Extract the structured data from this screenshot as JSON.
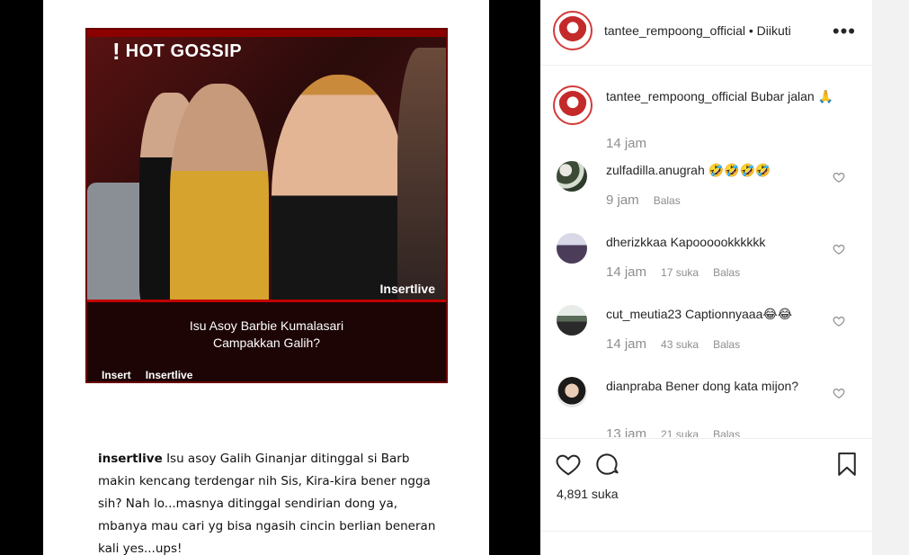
{
  "post": {
    "account": "tantee_rempoong_official",
    "separator": "•",
    "follow_status": "Diikuti",
    "caption": "Bubar jalan 🙏",
    "caption_time": "14 jam",
    "likes": "4,891 suka"
  },
  "media": {
    "badge": "HOT GOSSIP",
    "badge_icon": "!",
    "watermark": "Insertlive",
    "caption_line1": "Isu Asoy Barbie Kumalasari",
    "caption_line2": "Campakkan Galih?",
    "footer_logo1": "Insert",
    "footer_logo2": "Insertlive",
    "text_user": "insertlive",
    "text_body": "Isu asoy Galih Ginanjar ditinggal si Barb makin kencang terdengar nih Sis, Kira-kira bener ngga sih? Nah lo...masnya ditinggal sendirian dong ya, mbanya mau cari yg bisa ngasih cincin berlian beneran kali yes...ups!"
  },
  "comments": [
    {
      "user": "zulfadilla.anugrah",
      "text": "🤣🤣🤣🤣",
      "time": "9 jam",
      "likes": "",
      "reply": "Balas"
    },
    {
      "user": "dherizkkaa",
      "text": "Kapoooookkkkkk",
      "time": "14 jam",
      "likes": "17 suka",
      "reply": "Balas"
    },
    {
      "user": "cut_meutia23",
      "text": "Captionnyaaa😂😂",
      "time": "14 jam",
      "likes": "43 suka",
      "reply": "Balas"
    },
    {
      "user": "dianpraba",
      "text": "Bener dong kata mijon?",
      "time": "13 jam",
      "likes": "21 suka",
      "reply": "Balas"
    }
  ],
  "icons": {
    "like": "heart-icon",
    "comment": "comment-icon",
    "save": "bookmark-icon",
    "more": "ellipsis-icon"
  },
  "colors": {
    "avatar_ring": "#d33b3b",
    "media_frame": "#8b0000"
  }
}
